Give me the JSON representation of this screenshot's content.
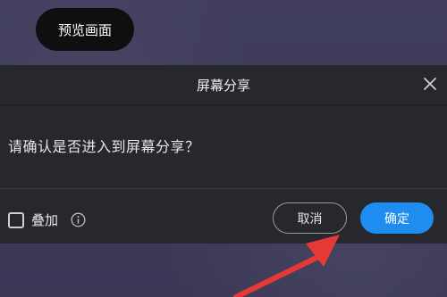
{
  "preview": {
    "label": "预览画面"
  },
  "dialog": {
    "title": "屏幕分享",
    "message": "请确认是否进入到屏幕分享？",
    "overlay_label": "叠加",
    "cancel_label": "取消",
    "confirm_label": "确定",
    "close_icon": "close-icon",
    "info_icon": "info-icon",
    "overlay_checked": false
  },
  "colors": {
    "dialog_bg": "#26282d",
    "confirm_bg": "#1f8cf0",
    "arrow": "#e53935",
    "page_bg": "#3f3d5a"
  }
}
